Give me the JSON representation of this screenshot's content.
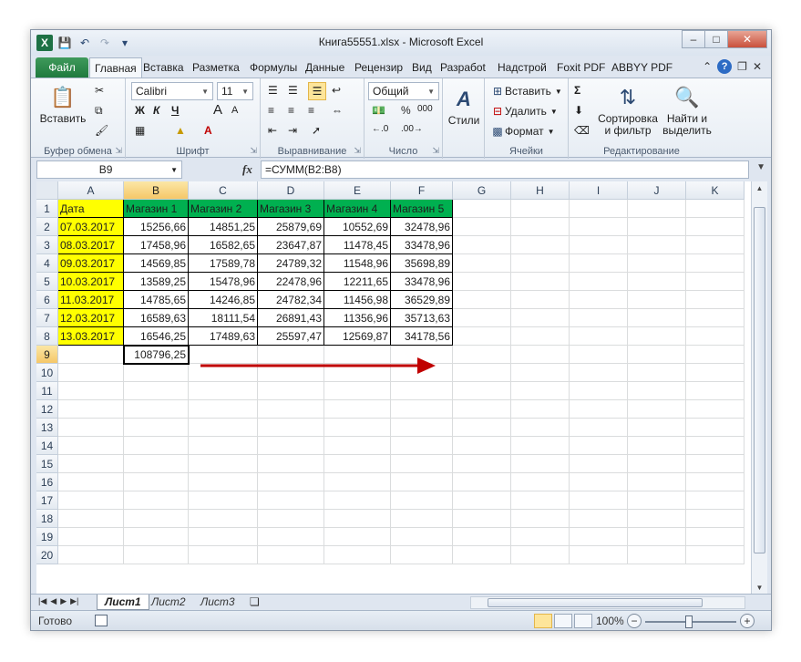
{
  "window": {
    "title": "Книга55551.xlsx - Microsoft Excel",
    "app_icon_letter": "X",
    "controls": {
      "minimize": "–",
      "maximize": "□",
      "close": "✕"
    }
  },
  "ribbon_tabs": [
    {
      "label": "Файл"
    },
    {
      "label": "Главная"
    },
    {
      "label": "Вставка"
    },
    {
      "label": "Разметка"
    },
    {
      "label": "Формулы"
    },
    {
      "label": "Данные"
    },
    {
      "label": "Рецензир"
    },
    {
      "label": "Вид"
    },
    {
      "label": "Разрабоt"
    },
    {
      "label": "Надстрой"
    },
    {
      "label": "Foxit PDF"
    },
    {
      "label": "ABBYY PDF"
    }
  ],
  "ribbon": {
    "clipboard": {
      "label": "Буфер обмена",
      "paste": "Вставить"
    },
    "font": {
      "label": "Шрифт",
      "name": "Calibri",
      "size": "11",
      "bold": "Ж",
      "italic": "К",
      "underline": "Ч",
      "grow": "A",
      "shrink": "A"
    },
    "alignment": {
      "label": "Выравнивание"
    },
    "number": {
      "label": "Число",
      "format": "Общий",
      "percent": "%",
      "thousands": "000"
    },
    "styles": {
      "label": "Стили"
    },
    "cells": {
      "label": "Ячейки",
      "insert": "Вставить",
      "delete": "Удалить",
      "format": "Формат"
    },
    "editing": {
      "label": "Редактирование",
      "sort": "Сортировка\nи фильтр",
      "find": "Найти и\nвыделить",
      "sigma": "Σ"
    }
  },
  "formula_bar": {
    "name_box": "B9",
    "fx": "fx",
    "formula": "=СУММ(B2:B8)"
  },
  "columns": [
    "A",
    "B",
    "C",
    "D",
    "E",
    "F",
    "G",
    "H",
    "I",
    "J",
    "K"
  ],
  "rows": [
    "1",
    "2",
    "3",
    "4",
    "5",
    "6",
    "7",
    "8",
    "9",
    "10",
    "11",
    "12",
    "13",
    "14",
    "15",
    "16",
    "17",
    "18",
    "19",
    "20"
  ],
  "table": {
    "headers": [
      "Дата",
      "Магазин 1",
      "Магазин 2",
      "Магазин 3",
      "Магазин 4",
      "Магазин 5"
    ],
    "rows": [
      [
        "07.03.2017",
        "15256,66",
        "14851,25",
        "25879,69",
        "10552,69",
        "32478,96"
      ],
      [
        "08.03.2017",
        "17458,96",
        "16582,65",
        "23647,87",
        "11478,45",
        "33478,96"
      ],
      [
        "09.03.2017",
        "14569,85",
        "17589,78",
        "24789,32",
        "11548,96",
        "35698,89"
      ],
      [
        "10.03.2017",
        "13589,25",
        "15478,96",
        "22478,96",
        "12211,65",
        "33478,96"
      ],
      [
        "11.03.2017",
        "14785,65",
        "14246,85",
        "24782,34",
        "11456,98",
        "36529,89"
      ],
      [
        "12.03.2017",
        "16589,63",
        "18111,54",
        "26891,43",
        "11356,96",
        "35713,63"
      ],
      [
        "13.03.2017",
        "16546,25",
        "17489,63",
        "25597,47",
        "12569,87",
        "34178,56"
      ]
    ],
    "sum_cell": "108796,25"
  },
  "sheets": [
    "Лист1",
    "Лист2",
    "Лист3"
  ],
  "status": {
    "ready": "Готово",
    "zoom": "100%"
  },
  "colors": {
    "header_fill": "#00b050",
    "date_fill": "#ffff00",
    "arrow": "#c00000"
  }
}
